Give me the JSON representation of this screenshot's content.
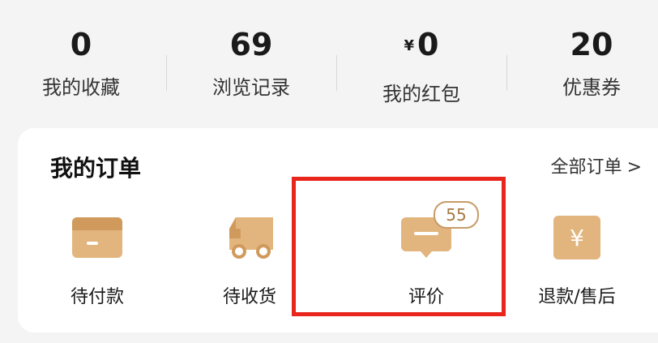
{
  "stats": [
    {
      "value": "0",
      "label": "我的收藏"
    },
    {
      "value": "69",
      "label": "浏览记录"
    },
    {
      "value": "0",
      "currency": "¥",
      "label": "我的红包"
    },
    {
      "value": "20",
      "label": "优惠券"
    }
  ],
  "orders": {
    "title": "我的订单",
    "all_label": "全部订单",
    "all_chevron": ">",
    "items": [
      {
        "label": "待付款",
        "icon": "wallet-icon"
      },
      {
        "label": "待收货",
        "icon": "truck-icon"
      },
      {
        "label": "评价",
        "icon": "comment-icon",
        "badge": "55"
      },
      {
        "label": "退款/售后",
        "icon": "yen-icon"
      }
    ]
  },
  "colors": {
    "icon_gold": "#d7a86e",
    "badge": "#c89b67",
    "highlight": "#e8261c"
  }
}
